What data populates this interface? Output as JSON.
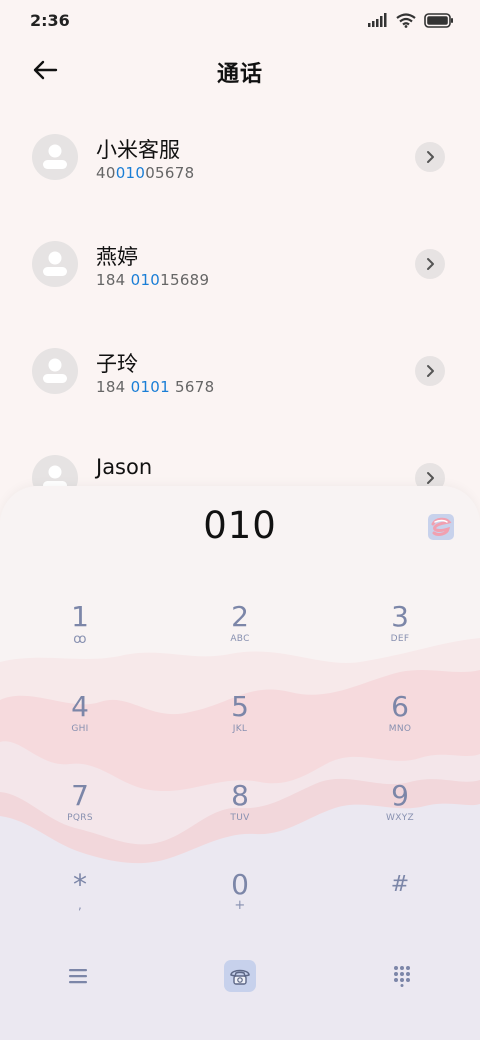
{
  "status_bar": {
    "time": "2:36"
  },
  "header": {
    "title": "通话"
  },
  "contacts": [
    {
      "name": "小米客服",
      "number_before": "40",
      "number_match": "010",
      "number_after": "05678"
    },
    {
      "name": "燕婷",
      "number_before": "184 ",
      "number_match": "010",
      "number_after": "15689"
    },
    {
      "name": "子玲",
      "number_before": "184 ",
      "number_match": "0101",
      "number_after": " 5678"
    },
    {
      "name": "Jason",
      "number_before": "",
      "number_match": "",
      "number_after": ""
    }
  ],
  "dialer": {
    "input": "010",
    "keys": [
      {
        "digit": "1",
        "letters": "ꝏ"
      },
      {
        "digit": "2",
        "letters": "ABC"
      },
      {
        "digit": "3",
        "letters": "DEF"
      },
      {
        "digit": "4",
        "letters": "GHI"
      },
      {
        "digit": "5",
        "letters": "JKL"
      },
      {
        "digit": "6",
        "letters": "MNO"
      },
      {
        "digit": "7",
        "letters": "PQRS"
      },
      {
        "digit": "8",
        "letters": "TUV"
      },
      {
        "digit": "9",
        "letters": "WXYZ"
      },
      {
        "digit": "*",
        "letters": ","
      },
      {
        "digit": "0",
        "letters": "+"
      },
      {
        "digit": "#",
        "letters": ""
      }
    ]
  },
  "colors": {
    "highlight": "#1a7ed6",
    "key_text": "#7c86a8",
    "panel_pink": "#f6d9dc",
    "panel_lavender": "#e9e8f2"
  },
  "icons": {
    "back": "arrow-left-icon",
    "detail": "chevron-right-icon",
    "menu": "menu-icon",
    "call": "phone-call-icon",
    "keypad": "keypad-grid-icon"
  }
}
